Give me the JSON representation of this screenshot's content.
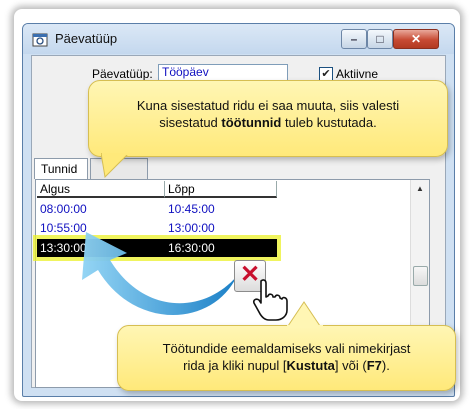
{
  "window": {
    "title": "Päevatüüp",
    "minimize_glyph": "–",
    "maximize_glyph": "□",
    "close_glyph": "✕"
  },
  "form": {
    "field_label": "Päevatüüp:",
    "field_value": "Tööpäev",
    "checkbox_label": "Aktiivne",
    "checkbox_checked": true
  },
  "tabs": [
    "Tunnid",
    ""
  ],
  "table": {
    "columns": [
      "Algus",
      "Lõpp"
    ],
    "rows": [
      {
        "start": "08:00:00",
        "end": "10:45:00"
      },
      {
        "start": "10:55:00",
        "end": "13:00:00"
      },
      {
        "start": "13:30:00",
        "end": "16:30:00"
      }
    ],
    "selected_row": 2
  },
  "callout_top": {
    "line1": "Kuna sisestatud ridu ei saa muuta, siis valesti",
    "line2_prefix": "sisestatud ",
    "line2_bold": "töötunnid",
    "line2_suffix": " tuleb kustutada."
  },
  "callout_bottom": {
    "line1": "Töötundide eemaldamiseks vali nimekirjast",
    "line2_prefix": "rida ja kliki nupul [",
    "line2_bold": "Kustuta",
    "line2_mid": "] või (",
    "line2_bold2": "F7",
    "line2_suffix": ")."
  },
  "delete_button": {
    "glyph": "✕"
  },
  "colors": {
    "accent_yellow": "#ffe97a",
    "selection": "#000000",
    "highlight": "#ebf028",
    "arrow_blue": "#1e9ad8",
    "link_blue": "#1010c0"
  },
  "icons": {
    "app": "app-icon",
    "delete": "delete-icon",
    "cursor": "hand-cursor-icon",
    "arrow": "curved-arrow-icon"
  }
}
